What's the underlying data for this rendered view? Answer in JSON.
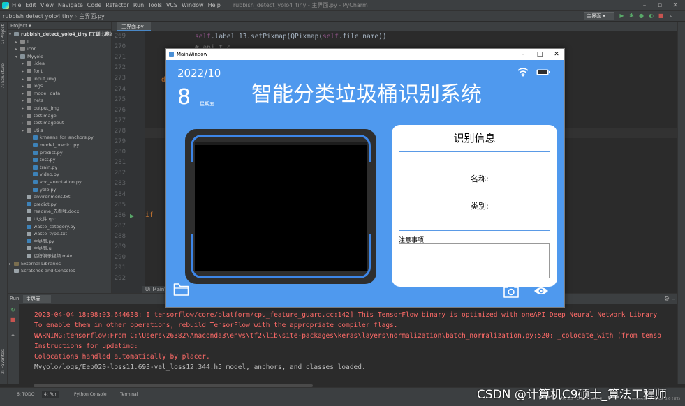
{
  "ide": {
    "menu": [
      "File",
      "Edit",
      "View",
      "Navigate",
      "Code",
      "Refactor",
      "Run",
      "Tools",
      "VCS",
      "Window",
      "Help"
    ],
    "window_title": "rubbish_detect_yolo4_tiny - 主界面.py - PyCharm",
    "breadcrumb": [
      "rubbish detect yolo4 tiny",
      "主界面.py"
    ],
    "run_config": "主界面",
    "project_label": "Project",
    "left_tabs": [
      "1: Project",
      "7: Structure",
      "2: Favorites"
    ],
    "project_tree": [
      {
        "label": "rubbish_detect_yolo4_tiny [工训比赛垃圾分类]",
        "depth": 0,
        "kind": "folder",
        "expanded": true,
        "root": true
      },
      {
        "label": "l",
        "depth": 1,
        "kind": "folder",
        "expanded": false
      },
      {
        "label": "icon",
        "depth": 1,
        "kind": "folder",
        "expanded": false
      },
      {
        "label": "Myyolo",
        "depth": 1,
        "kind": "folder",
        "expanded": true
      },
      {
        "label": ".idea",
        "depth": 2,
        "kind": "folder",
        "expanded": false
      },
      {
        "label": "font",
        "depth": 2,
        "kind": "folder",
        "expanded": false
      },
      {
        "label": "input_img",
        "depth": 2,
        "kind": "folder",
        "expanded": false
      },
      {
        "label": "logs",
        "depth": 2,
        "kind": "folder",
        "expanded": false
      },
      {
        "label": "model_data",
        "depth": 2,
        "kind": "folder",
        "expanded": false
      },
      {
        "label": "nets",
        "depth": 2,
        "kind": "folder",
        "expanded": false
      },
      {
        "label": "output_img",
        "depth": 2,
        "kind": "folder",
        "expanded": false
      },
      {
        "label": "testimage",
        "depth": 2,
        "kind": "folder",
        "expanded": false
      },
      {
        "label": "testimageout",
        "depth": 2,
        "kind": "folder",
        "expanded": false
      },
      {
        "label": "utils",
        "depth": 2,
        "kind": "folder",
        "expanded": false
      },
      {
        "label": "kmeans_for_anchors.py",
        "depth": 3,
        "kind": "py"
      },
      {
        "label": "model_predict.py",
        "depth": 3,
        "kind": "py"
      },
      {
        "label": "predict.py",
        "depth": 3,
        "kind": "py"
      },
      {
        "label": "test.py",
        "depth": 3,
        "kind": "py"
      },
      {
        "label": "train.py",
        "depth": 3,
        "kind": "py"
      },
      {
        "label": "video.py",
        "depth": 3,
        "kind": "py"
      },
      {
        "label": "voc_annotation.py",
        "depth": 3,
        "kind": "py"
      },
      {
        "label": "yolo.py",
        "depth": 3,
        "kind": "py"
      },
      {
        "label": "environment.txt",
        "depth": 2,
        "kind": "file"
      },
      {
        "label": "predict.py",
        "depth": 2,
        "kind": "py"
      },
      {
        "label": "readme_先看我.docx",
        "depth": 2,
        "kind": "file"
      },
      {
        "label": "UI文件.qrc",
        "depth": 2,
        "kind": "file"
      },
      {
        "label": "waste_category.py",
        "depth": 2,
        "kind": "py"
      },
      {
        "label": "waste_type.txt",
        "depth": 2,
        "kind": "file"
      },
      {
        "label": "主界面.py",
        "depth": 2,
        "kind": "py"
      },
      {
        "label": "主界面.ui",
        "depth": 2,
        "kind": "file"
      },
      {
        "label": "运行演示视频.m4v",
        "depth": 2,
        "kind": "file"
      },
      {
        "label": "External Libraries",
        "depth": 0,
        "kind": "lib",
        "expanded": false
      },
      {
        "label": "Scratches and Consoles",
        "depth": 0,
        "kind": "file"
      }
    ],
    "editor_tab": "主界面.py",
    "line_numbers": [
      "269",
      "270",
      "271",
      "272",
      "273",
      "274",
      "275",
      "276",
      "277",
      "278",
      "279",
      "280",
      "281",
      "282",
      "283",
      "284",
      "285",
      "286",
      "287",
      "288",
      "289",
      "290",
      "291",
      "292"
    ],
    "code_lines": [
      {
        "line": "269",
        "text": "        self.label_13.setPixmap(QPixmap(self.file_name))"
      },
      {
        "line": "270",
        "text": "        # api.t.c"
      },
      {
        "line": "273",
        "text": "d"
      },
      {
        "line": "286",
        "text": "if"
      }
    ],
    "editor_bottom_label": "Ui_MainW",
    "run_label": "Run:",
    "run_tab": "主界面",
    "console_lines": [
      {
        "text": "2023-04-04 18:08:03.644638: I tensorflow/core/platform/cpu_feature_guard.cc:142] This TensorFlow binary is optimized with oneAPI Deep Neural Network Library",
        "kind": "err"
      },
      {
        "text": "To enable them in other operations, rebuild TensorFlow with the appropriate compiler flags.",
        "kind": "err"
      },
      {
        "text": "WARNING:tensorflow:From C:\\Users\\26382\\Anaconda3\\envs\\tf2\\lib\\site-packages\\keras\\layers\\normalization\\batch_normalization.py:520: _colocate_with (from tenso",
        "kind": "err"
      },
      {
        "text": "Instructions for updating:",
        "kind": "err"
      },
      {
        "text": "Colocations handled automatically by placer.",
        "kind": "err"
      },
      {
        "text": "Myyolo/logs/Eep020-loss11.693-val_loss12.344.h5 model, anchors, and classes loaded.",
        "kind": "out"
      }
    ],
    "status_tabs": [
      "6: TODO",
      "4: Run",
      "Python Console",
      "Terminal"
    ],
    "status_right": [
      "276:65",
      "CRLF",
      "UTF-8",
      "4 spaces",
      "Python 3.6 (tf2)"
    ]
  },
  "app": {
    "window_title": "MainWindow",
    "date": "2022/10",
    "day": "8",
    "weekday": "星期五",
    "title": "智能分类垃圾桶识别系统",
    "info_title": "识别信息",
    "name_label": "名称:",
    "category_label": "类别:",
    "notes_label": "注意事项",
    "icons": [
      "wifi-icon",
      "battery-icon",
      "folder-icon",
      "camera-icon",
      "eye-icon"
    ],
    "colors": {
      "accent": "#4f99ee",
      "frame": "#3d86e8",
      "tablet": "#2e2e2e"
    }
  },
  "watermark": "CSDN @计算机C9硕士_算法工程师"
}
